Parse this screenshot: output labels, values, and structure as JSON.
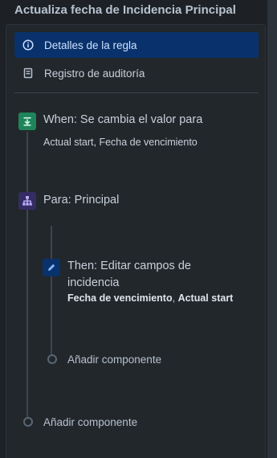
{
  "page": {
    "title": "Actualiza fecha de Incidencia Principal"
  },
  "nav": {
    "items": [
      {
        "label": "Detalles de la regla",
        "icon": "info-icon",
        "active": true
      },
      {
        "label": "Registro de auditoría",
        "icon": "audit-log-icon",
        "active": false
      }
    ]
  },
  "flow": {
    "trigger": {
      "title": "When: Se cambia el valor para",
      "subtitle": "Actual start, Fecha de vencimiento",
      "icon": "trigger-icon",
      "color": "#1f845a"
    },
    "branch": {
      "title": "Para: Principal",
      "icon": "branch-icon",
      "color": "#352c63"
    },
    "action": {
      "title_line1": "Then: Editar campos de",
      "title_line2": "incidencia",
      "field1": "Fecha de vencimiento",
      "separator": ",",
      "field2": "Actual start",
      "icon": "edit-icon",
      "color": "#09326c"
    },
    "add_inner": "Añadir componente",
    "add_outer": "Añadir componente"
  },
  "colors": {
    "background": "#1d2125",
    "panel": "#22272b",
    "active_nav": "#09326c"
  }
}
